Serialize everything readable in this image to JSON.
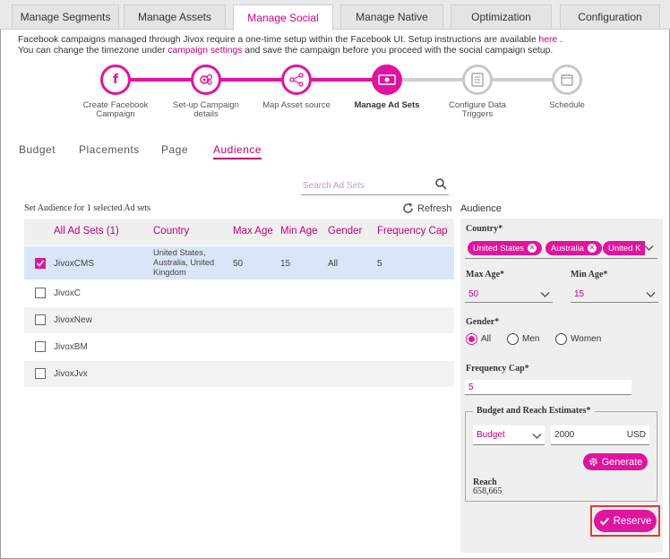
{
  "top_tabs": [
    {
      "label": "Manage Segments"
    },
    {
      "label": "Manage Assets"
    },
    {
      "label": "Manage Social",
      "active": true
    },
    {
      "label": "Manage Native"
    },
    {
      "label": "Optimization"
    },
    {
      "label": "Configuration"
    }
  ],
  "info": {
    "line1_prefix": "Facebook campaigns managed through Jivox require a one-time setup within the Facebook UI. Setup instructions are available ",
    "line1_link": "here",
    "line1_suffix": " .",
    "line2_prefix": "You can change the timezone under ",
    "line2_link": "campaign settings",
    "line2_suffix": " and save the campaign before you proceed with the social campaign setup."
  },
  "steps": [
    {
      "label": "Create Facebook Campaign",
      "state": "done",
      "icon": "facebook-icon"
    },
    {
      "label": "Set-up Campaign details",
      "state": "done",
      "icon": "gears-icon"
    },
    {
      "label": "Map Asset source",
      "state": "done",
      "icon": "share-nodes-icon"
    },
    {
      "label": "Manage Ad Sets",
      "state": "active",
      "icon": "money-icon"
    },
    {
      "label": "Configure Data Triggers",
      "state": "todo",
      "icon": "list-icon"
    },
    {
      "label": "Schedule",
      "state": "todo",
      "icon": "calendar-icon"
    }
  ],
  "sub_tabs": [
    {
      "label": "Budget"
    },
    {
      "label": "Placements"
    },
    {
      "label": "Page"
    },
    {
      "label": "Audience",
      "active": true
    }
  ],
  "search": {
    "placeholder": "Search Ad Sets"
  },
  "left_title": "Set Audience for 1 selected Ad sets",
  "refresh_label": "Refresh",
  "table": {
    "headers": [
      "All Ad Sets (1)",
      "Country",
      "Max Age",
      "Min Age",
      "Gender",
      "Frequency Cap"
    ],
    "rows": [
      {
        "name": "JivoxCMS",
        "country": "United States, Australia, United Kingdom",
        "max_age": "50",
        "min_age": "15",
        "gender": "All",
        "freq": "5",
        "checked": true
      },
      {
        "name": "JivoxC",
        "country": "",
        "max_age": "",
        "min_age": "",
        "gender": "",
        "freq": "",
        "checked": false
      },
      {
        "name": "JivoxNew",
        "country": "",
        "max_age": "",
        "min_age": "",
        "gender": "",
        "freq": "",
        "checked": false
      },
      {
        "name": "JivoxBM",
        "country": "",
        "max_age": "",
        "min_age": "",
        "gender": "",
        "freq": "",
        "checked": false
      },
      {
        "name": "JivoxJvx",
        "country": "",
        "max_age": "",
        "min_age": "",
        "gender": "",
        "freq": "",
        "checked": false
      }
    ]
  },
  "audience": {
    "title": "Audience",
    "country_label": "Country*",
    "countries": [
      "United States",
      "Australia",
      "United K"
    ],
    "max_age_label": "Max Age*",
    "max_age": "50",
    "min_age_label": "Min Age*",
    "min_age": "15",
    "gender_label": "Gender*",
    "gender_options": [
      "All",
      "Men",
      "Women"
    ],
    "gender_selected": "All",
    "freq_label": "Frequency Cap*",
    "freq_value": "5",
    "estimates_label": "Budget and Reach Estimates*",
    "budget_type": "Budget",
    "budget_value": "2000",
    "currency": "USD",
    "generate_label": "Generate",
    "reach_label": "Reach",
    "reach_value": "658,665",
    "reserve_label": "Reserve"
  },
  "colors": {
    "accent": "#e0149f",
    "highlight_box": "#e53935"
  }
}
